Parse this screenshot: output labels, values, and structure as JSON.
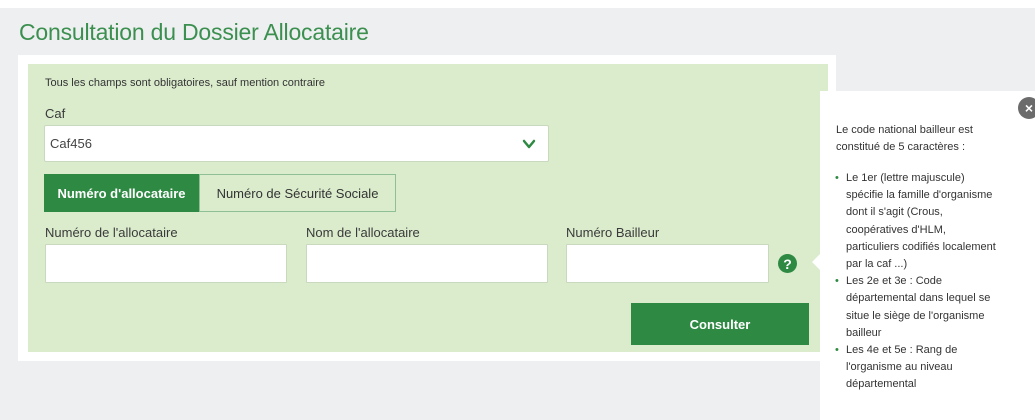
{
  "page": {
    "title": "Consultation du Dossier Allocataire"
  },
  "form": {
    "mandatory_notice": "Tous les champs sont obligatoires, sauf mention contraire",
    "caf_label": "Caf",
    "caf_selected": "Caf456",
    "tabs": [
      {
        "label": "Numéro d'allocataire",
        "active": true
      },
      {
        "label": "Numéro de Sécurité Sociale",
        "active": false
      }
    ],
    "fields": [
      {
        "label": "Numéro de l'allocataire",
        "value": ""
      },
      {
        "label": "Nom de l'allocataire",
        "value": ""
      },
      {
        "label": "Numéro Bailleur",
        "value": ""
      }
    ],
    "help_icon_glyph": "?",
    "submit_label": "Consulter"
  },
  "tooltip": {
    "close_glyph": "×",
    "intro_line1": "Le code national bailleur est",
    "intro_line2": "constitué de 5 caractères :",
    "items": [
      {
        "lines": [
          "Le 1er (lettre majuscule)",
          "spécifie la famille d'organisme",
          "dont il s'agit (Crous,",
          "coopératives d'HLM,",
          "particuliers codifiés localement",
          "par la caf ...)"
        ]
      },
      {
        "lines": [
          "Les 2e et 3e : Code",
          "départemental dans lequel se",
          "situe le siège de l'organisme",
          "bailleur"
        ]
      },
      {
        "lines": [
          "Les 4e et 5e : Rang de",
          "l'organisme au niveau",
          "départemental"
        ]
      }
    ]
  },
  "icons": {
    "chevron": "chevron-down-icon",
    "help": "question-mark-icon",
    "close": "close-icon"
  },
  "colors": {
    "brand_green": "#2e8a43",
    "title_green": "#3b8f4f",
    "panel_bg": "#dbeccd",
    "page_bg": "#eeeff1"
  }
}
